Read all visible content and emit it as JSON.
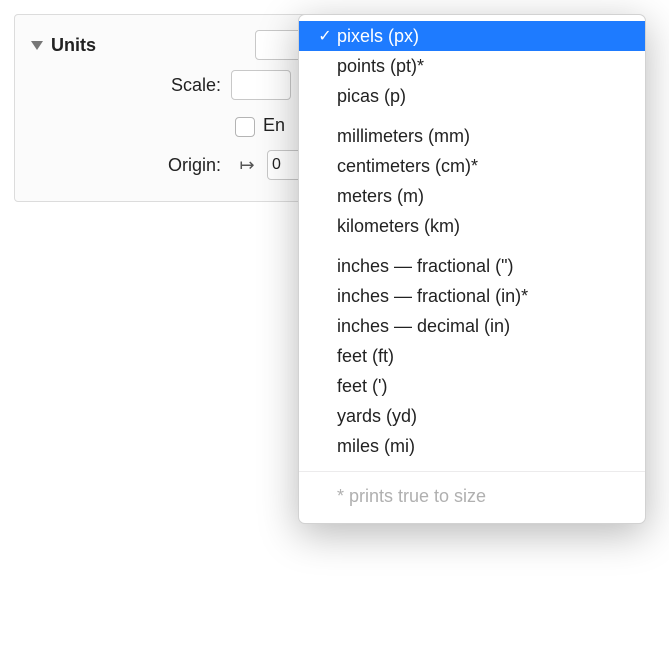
{
  "section": {
    "title": "Units"
  },
  "labels": {
    "scale": "Scale:",
    "origin": "Origin:",
    "ensure_prefix": "En"
  },
  "scale": {
    "value": ""
  },
  "origin": {
    "value": "0"
  },
  "dropdown": {
    "groups": [
      [
        "pixels (px)",
        "points (pt)*",
        "picas (p)"
      ],
      [
        "millimeters (mm)",
        "centimeters (cm)*",
        "meters (m)",
        "kilometers (km)"
      ],
      [
        "inches — fractional (\")",
        "inches — fractional (in)*",
        "inches — decimal (in)",
        "feet (ft)",
        "feet (')",
        "yards (yd)",
        "miles (mi)"
      ]
    ],
    "selected": "pixels (px)",
    "footer": "* prints true to size"
  }
}
